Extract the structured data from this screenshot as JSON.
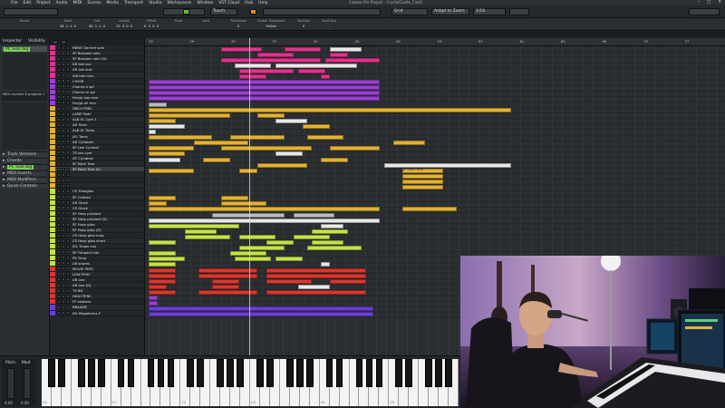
{
  "window": {
    "title": "Cubase Pro Project - CrystalCastle_Cast2"
  },
  "menu": [
    "File",
    "Edit",
    "Project",
    "Audio",
    "MIDI",
    "Scores",
    "Media",
    "Transport",
    "Studio",
    "Workspaces",
    "Window",
    "VST Cloud",
    "Hub",
    "Help"
  ],
  "toolbar": {
    "automation_mode": "Touch",
    "snap": "Grid",
    "zoom_mode": "Adapt to Zoom",
    "quantize": "1/16"
  },
  "infoline": [
    {
      "label": "Name",
      "value": ""
    },
    {
      "label": "Start",
      "value": "26. 1. 1. 0"
    },
    {
      "label": "End",
      "value": "45. 1. 1. 0"
    },
    {
      "label": "Length",
      "value": "19. 0. 0. 0"
    },
    {
      "label": "Offset",
      "value": "0. 0. 0. 0"
    },
    {
      "label": "Mute",
      "value": ""
    },
    {
      "label": "Lock",
      "value": ""
    },
    {
      "label": "Transpose",
      "value": "0"
    },
    {
      "label": "Global Transpose",
      "value": "Follow"
    },
    {
      "label": "Velocity",
      "value": "0"
    },
    {
      "label": "Root Key",
      "value": "-"
    }
  ],
  "inspector": {
    "tabs": [
      "Inspector",
      "Visibility"
    ],
    "track_name": "PC Solo big",
    "sections": [
      "Track Versions",
      "Chords",
      "PC Solo big",
      "MIDI Inserts",
      "MIDI Modifiers",
      "Quick Controls"
    ],
    "midi_channel": "MIDI channel 8 program 1"
  },
  "tracks": [
    {
      "name": "RWW Clarinet solo",
      "color": "#e0338c"
    },
    {
      "name": "SF Bassoon solo",
      "color": "#e0338c"
    },
    {
      "name": "SF Bassoon solo (D)",
      "color": "#e0338c"
    },
    {
      "name": "AR low sus",
      "color": "#e0338c"
    },
    {
      "name": "AR low stac",
      "color": "#e0338c"
    },
    {
      "name": "Alb low runs",
      "color": "#e0338c"
    },
    {
      "name": "CHOIR",
      "color": "#9b3fd6"
    },
    {
      "name": "Chorus 4 spl",
      "color": "#9b3fd6"
    },
    {
      "name": "Chorus m spl",
      "color": "#9b3fd6"
    },
    {
      "name": "Freyja oop mm",
      "color": "#9b3fd6"
    },
    {
      "name": "Freyja oh mm",
      "color": "#9b3fd6"
    },
    {
      "name": "ORCH PERC",
      "color": "#e3b234"
    },
    {
      "name": "LAMP Pwhl",
      "color": "#e3b234"
    },
    {
      "name": "ALB XL Cym 1",
      "color": "#e3b234"
    },
    {
      "name": "AR Toms",
      "color": "#e3b234"
    },
    {
      "name": "ALB XL Toms",
      "color": "#e3b234"
    },
    {
      "name": "JXL Toms",
      "color": "#e3b234"
    },
    {
      "name": "AR Cymbals",
      "color": "#e3b234"
    },
    {
      "name": "SF Low Cymbal",
      "color": "#e3b234"
    },
    {
      "name": "TS sus cym",
      "color": "#e3b234"
    },
    {
      "name": "GT Cymbals",
      "color": "#e3b234"
    },
    {
      "name": "SF Mark Tree",
      "color": "#e3b234"
    },
    {
      "name": "SF Mark Tree (E)",
      "color": "#e3b234"
    },
    {
      "name": "",
      "color": "#e3b234"
    },
    {
      "name": "",
      "color": "#e3b234"
    },
    {
      "name": "",
      "color": "#e3b234"
    },
    {
      "name": "CS Triangles",
      "color": "#c6e24a"
    },
    {
      "name": "SF Celeste",
      "color": "#c6e24a"
    },
    {
      "name": "AR Glock",
      "color": "#c6e24a"
    },
    {
      "name": "CS Glock",
      "color": "#c6e24a"
    },
    {
      "name": "SF Harp plucked",
      "color": "#c6e24a"
    },
    {
      "name": "SF Harp plucked (D)",
      "color": "#c6e24a"
    },
    {
      "name": "SF Harp gliss",
      "color": "#c6e24a"
    },
    {
      "name": "SF Harp gliss (D)",
      "color": "#c6e24a"
    },
    {
      "name": "CS Harp gliss long",
      "color": "#c6e24a"
    },
    {
      "name": "CS Harp gliss short",
      "color": "#c6e24a"
    },
    {
      "name": "JXL Timps sus",
      "color": "#c6e24a"
    },
    {
      "name": "SF Timpani hits",
      "color": "#c6e24a"
    },
    {
      "name": "PS Timp",
      "color": "#c6e24a"
    },
    {
      "name": "AR snares",
      "color": "#c6e24a"
    },
    {
      "name": "MOVIE PERC",
      "color": "#d8382e"
    },
    {
      "name": "LOW PERC",
      "color": "#d8382e"
    },
    {
      "name": "AR one",
      "color": "#d8382e"
    },
    {
      "name": "AR one (D)",
      "color": "#d8382e"
    },
    {
      "name": "TS BD",
      "color": "#d8382e"
    },
    {
      "name": "HIGH PERC",
      "color": "#d8382e"
    },
    {
      "name": "FP shakers",
      "color": "#d8382e"
    },
    {
      "name": "BRAAMS",
      "color": "#6c3fd8"
    },
    {
      "name": "DV Megahorns F",
      "color": "#6c3fd8"
    }
  ],
  "ruler": [
    "25",
    "29",
    "33",
    "37",
    "41",
    "45",
    "49",
    "53",
    "57",
    "61",
    "65",
    "69",
    "73",
    "77",
    "81"
  ],
  "note_label": "SF Mark Tree",
  "keyboard": {
    "pitch_label": "Pitch",
    "mod_label": "Mod",
    "pitch_value": "0.00",
    "mod_value": "0.00",
    "octaves": [
      "C0",
      "C1",
      "C2",
      "C3",
      "C4",
      "C5"
    ]
  },
  "colors": {
    "pink": "#e0338c",
    "purple": "#9b3fd6",
    "yellow": "#e3b234",
    "lime": "#c6e24a",
    "red": "#d8382e",
    "violet": "#6c3fd8",
    "accent_green": "#7fcf5a"
  }
}
